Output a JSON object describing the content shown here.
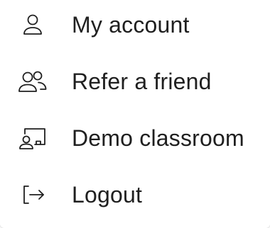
{
  "menu": {
    "items": [
      {
        "label": "My account",
        "icon": "user-icon"
      },
      {
        "label": "Refer a friend",
        "icon": "users-icon"
      },
      {
        "label": "Demo classroom",
        "icon": "classroom-icon"
      },
      {
        "label": "Logout",
        "icon": "logout-icon"
      }
    ]
  },
  "colors": {
    "text": "#1f1f1f",
    "icon_stroke": "#1f1f1f",
    "background": "#ffffff"
  }
}
